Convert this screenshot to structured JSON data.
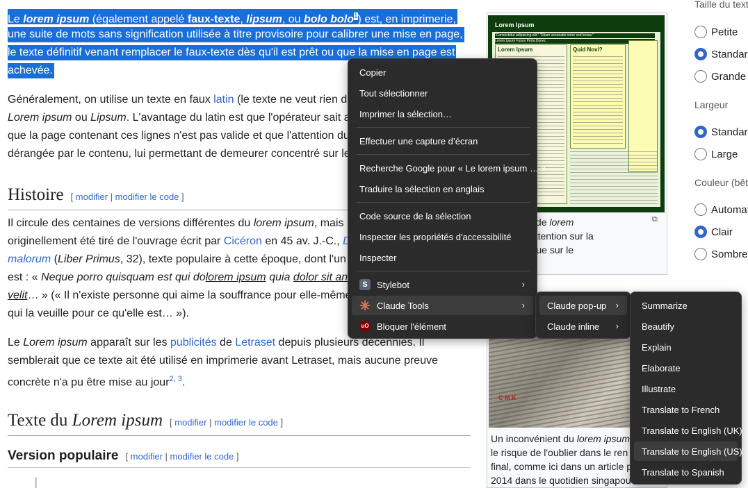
{
  "article": {
    "intro": {
      "sel_l1_a": "Le ",
      "sel_l1_b": "lorem ipsum",
      "sel_l1_c": " (également appelé ",
      "sel_l1_d": "faux-texte",
      "sel_l1_e": ", ",
      "sel_l1_f": "lipsum",
      "sel_l1_g": ", ou ",
      "sel_l1_h": "bolo bolo",
      "sel_l1_sup": "1",
      "sel_l1_i": ") est, en imprimerie,",
      "sel_l2": "une suite de mots sans signification utilisée à titre provisoire pour calibrer une mise en page,",
      "sel_l3": "le texte définitif venant remplacer le faux-texte dès qu'il est prêt ou que la mise en page est",
      "sel_l4": "achevée."
    },
    "p2": {
      "l1_a": "Généralement, on utilise un texte en faux ",
      "l1_link": "latin",
      "l1_b": " (le texte ne veut rien d",
      "l2_a": "Lorem ipsum",
      "l2_b": " ou ",
      "l2_c": "Lipsum",
      "l2_d": ". L'avantage du latin est que l'opérateur sait a",
      "l3": "que la page contenant ces lignes n'est pas valide et que l'attention du",
      "l4": "dérangée par le contenu, lui permettant de demeurer concentré sur le"
    },
    "histoire": {
      "title": "Histoire",
      "edit": "modifier",
      "edit_code": "modifier le code"
    },
    "p3": {
      "l1_a": "Il circule des centaines de versions différentes du ",
      "l1_b": "lorem ipsum",
      "l1_c": ", mais",
      "l2_a": "originellement été tiré de l'ouvrage écrit par ",
      "l2_link": "Cicéron",
      "l2_b": " en 45 av. J.-C., ",
      "l2_c": "D",
      "l3_a": "malorum",
      "l3_b": " (",
      "l3_c": "Liber Primus",
      "l3_d": ", 32), texte populaire à cette époque, dont l'un",
      "l4_a": "est : « ",
      "l4_b": "Neque porro quisquam est qui do",
      "l4_c": "lorem ipsum",
      "l4_d": " quia ",
      "l4_e": "dolor sit an",
      "l5_a": "velit",
      "l5_b": "… » (« Il n'existe personne qui aime la souffrance pour elle-même",
      "l6": "qui la veuille pour ce qu'elle est… »)."
    },
    "p4": {
      "l1_a": "Le ",
      "l1_b": "Lorem ipsum",
      "l1_c": " apparaît sur les ",
      "l1_link1": "publicités",
      "l1_d": " de ",
      "l1_link2": "Letraset",
      "l1_e": " depuis plusieurs décennies. Il",
      "l2": "semblerait que ce texte ait été utilisé en imprimerie avant Letraset, mais aucune preuve",
      "l3_a": "concrète n'a pu être mise au jour",
      "l3_sup": "2, 3",
      "l3_b": "."
    },
    "texte": {
      "title_a": "Texte du ",
      "title_b": "Lorem ipsum",
      "edit": "modifier",
      "edit_code": "modifier le code"
    },
    "version": {
      "title": "Version populaire",
      "edit": "modifier",
      "edit_code": "modifier le code"
    }
  },
  "figure": {
    "thumb_title": "Lorem Ipsum",
    "thumb_sub": "\"Consectetur adipiscing elit.\" \"Etiam venenatis tortor sed lectus.\"",
    "thumb_nav": "Lorem Ipsum   Fusce  Porta  Donec",
    "thumb_col1_title": "Lorem Ipsum",
    "thumb_col2_title": "Quid Novi?",
    "caption_l1_a": "'utilisation de ",
    "caption_l1_b": "lorem",
    "caption_l2": "d'attirer l'attention sur la",
    "caption_l3": "ge plutôt que sur le",
    "caption2_l1_a": "Un inconvénient du ",
    "caption2_l1_b": "lorem ipsum",
    "caption2_l2": "le risque de l'oublier dans le ren",
    "caption2_l3": "final, comme ici dans un article p",
    "caption2_l4": "2014 dans le quotidien singapou"
  },
  "sidebar": {
    "size_title": "Taille du text",
    "size_options": [
      "Petite",
      "Standard",
      "Grande"
    ],
    "width_title": "Largeur",
    "width_options": [
      "Standard",
      "Large"
    ],
    "color_title": "Couleur (bêt",
    "color_options": [
      "Automat",
      "Clair",
      "Sombre"
    ]
  },
  "context_menu": {
    "copy": "Copier",
    "select_all": "Tout sélectionner",
    "print_selection": "Imprimer la sélection…",
    "screenshot": "Effectuer une capture d’écran",
    "google_search": "Recherche Google pour « Le lorem ipsum … »",
    "translate": "Traduire la sélection en anglais",
    "view_source": "Code source de la sélection",
    "inspect_a11y": "Inspecter les propriétés d'accessibilité",
    "inspect": "Inspecter",
    "stylebot": "Stylebot",
    "claude_tools": "Claude Tools",
    "block_element": "Bloquer l'élément"
  },
  "claude_submenu": {
    "popup": "Claude pop-up",
    "inline": "Claude inline"
  },
  "popup_submenu": {
    "items": [
      "Summarize",
      "Beautify",
      "Explain",
      "Elaborate",
      "Illustrate",
      "Translate to French",
      "Translate to English (UK)",
      "Translate to English (US)",
      "Translate to Spanish"
    ]
  },
  "colors": {
    "selection": "#1a6ed8",
    "link": "#3366cc",
    "menu_bg": "#2b2b2b",
    "radio_checked": "#3366cc"
  }
}
